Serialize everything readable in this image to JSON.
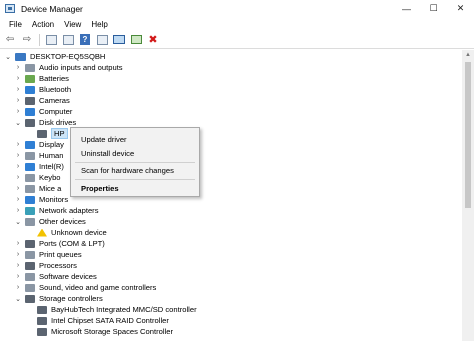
{
  "window": {
    "title": "Device Manager",
    "controls": [
      "—",
      "☐",
      "✕"
    ]
  },
  "menubar": [
    "File",
    "Action",
    "View",
    "Help"
  ],
  "tree": {
    "root": "DESKTOP-EQ5SQBH",
    "categories": [
      "Audio inputs and outputs",
      "Batteries",
      "Bluetooth",
      "Cameras",
      "Computer",
      "Disk drives",
      "HP",
      "Display",
      "Human",
      "Intel(R)",
      "Keybo",
      "Mice a",
      "Monitors",
      "Network adapters",
      "Other devices",
      "Unknown device",
      "Ports (COM & LPT)",
      "Print queues",
      "Processors",
      "Software devices",
      "Sound, video and game controllers",
      "Storage controllers",
      "BayHubTech Integrated MMC/SD controller",
      "Intel Chipset SATA RAID Controller",
      "Microsoft Storage Spaces Controller"
    ]
  },
  "context_menu": {
    "update": "Update driver",
    "uninstall": "Uninstall device",
    "scan": "Scan for hardware changes",
    "properties": "Properties"
  }
}
